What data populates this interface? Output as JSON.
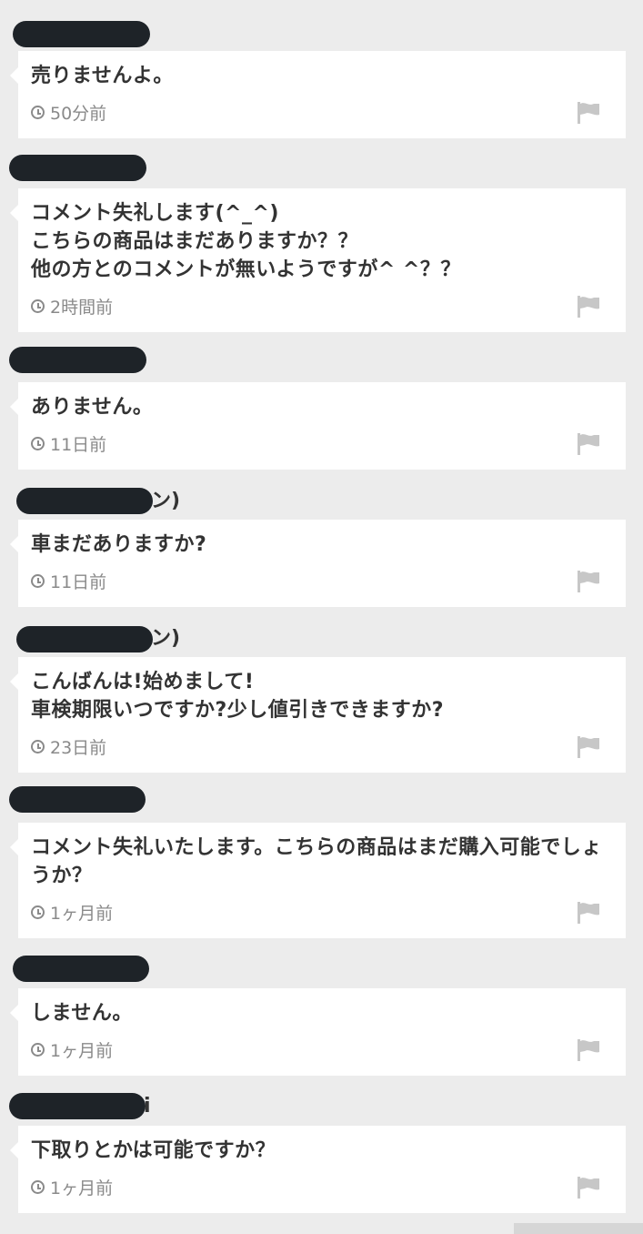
{
  "comments": [
    {
      "text": "売りませんよ。",
      "time": "50分前",
      "name_suffix": ""
    },
    {
      "text": "コメント失礼します(^_^)\nこちらの商品はまだありますか？？\n他の方とのコメントが無いようですが^ ^？？",
      "time": "2時間前",
      "name_suffix": ""
    },
    {
      "text": "ありません。",
      "time": "11日前",
      "name_suffix": ""
    },
    {
      "text": "車まだありますか?",
      "time": "11日前",
      "name_suffix": "ン)"
    },
    {
      "text": "こんばんは!始めまして!\n車検期限いつですか?少し値引きできますか?",
      "time": "23日前",
      "name_suffix": "ン)"
    },
    {
      "text": "コメント失礼いたします。こちらの商品はまだ購入可能でしょうか？",
      "time": "1ヶ月前",
      "name_suffix": ""
    },
    {
      "text": "しません。",
      "time": "1ヶ月前",
      "name_suffix": ""
    },
    {
      "text": "下取りとかは可能ですか？",
      "time": "1ヶ月前",
      "name_suffix": "i"
    }
  ],
  "icons": {
    "time": "clock-icon",
    "report": "flag-icon"
  },
  "colors": {
    "background": "#ececec",
    "bubble": "#ffffff",
    "redaction": "#1e2328",
    "meta_text": "#8a8a8a"
  }
}
